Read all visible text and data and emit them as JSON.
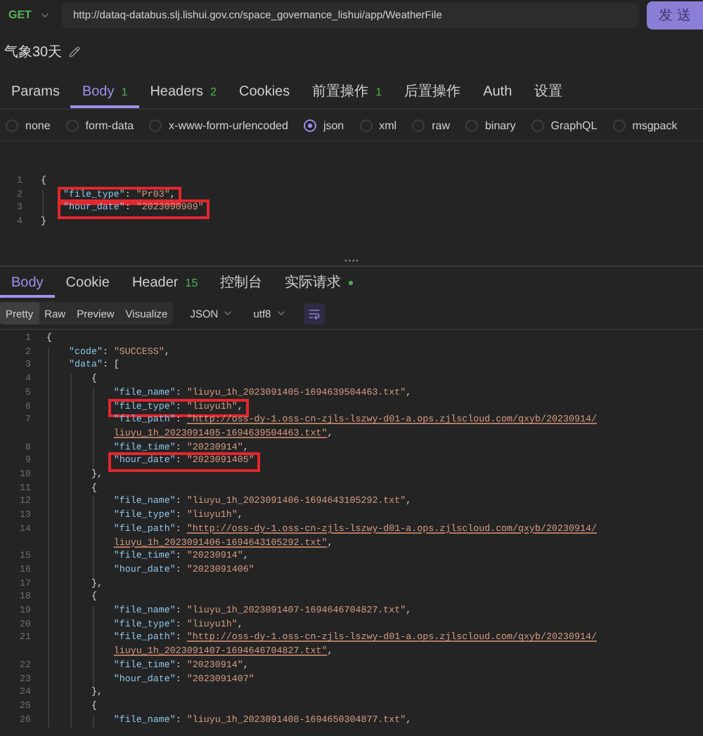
{
  "request": {
    "method": "GET",
    "url": "http://dataq-databus.slj.lishui.gov.cn/space_governance_lishui/app/WeatherFile",
    "send": "发 送"
  },
  "title": "气象30天",
  "tabs": [
    {
      "label": "Params",
      "selected": false
    },
    {
      "label": "Body",
      "count": "1",
      "selected": true
    },
    {
      "label": "Headers",
      "count": "2",
      "selected": false
    },
    {
      "label": "Cookies",
      "selected": false
    },
    {
      "label": "前置操作",
      "count": "1",
      "selected": false
    },
    {
      "label": "后置操作",
      "selected": false
    },
    {
      "label": "Auth",
      "selected": false
    },
    {
      "label": "设置",
      "selected": false
    }
  ],
  "body_types": [
    {
      "label": "none",
      "selected": false
    },
    {
      "label": "form-data",
      "selected": false
    },
    {
      "label": "x-www-form-urlencoded",
      "selected": false
    },
    {
      "label": "json",
      "selected": true
    },
    {
      "label": "xml",
      "selected": false
    },
    {
      "label": "raw",
      "selected": false
    },
    {
      "label": "binary",
      "selected": false
    },
    {
      "label": "GraphQL",
      "selected": false
    },
    {
      "label": "msgpack",
      "selected": false
    }
  ],
  "request_body": {
    "lines": [
      {
        "number": "1",
        "boxed": false,
        "tokens": [
          {
            "kind": "punct",
            "text": "{"
          }
        ],
        "children": [
          {
            "number": "2",
            "boxed": true,
            "tokens": [
              {
                "kind": "key",
                "text": "\"file_type\""
              },
              {
                "kind": "punct",
                "text": ": "
              },
              {
                "kind": "string",
                "text": "\"Pr03\""
              },
              {
                "kind": "punct",
                "text": ","
              }
            ]
          },
          {
            "number": "3",
            "boxed": true,
            "tokens": [
              {
                "kind": "key",
                "text": "\"hour_date\""
              },
              {
                "kind": "punct",
                "text": ": "
              },
              {
                "kind": "string",
                "text": "\"2023090909\""
              }
            ]
          }
        ]
      },
      {
        "number": "4",
        "boxed": false,
        "tokens": [
          {
            "kind": "punct",
            "text": "}"
          }
        ]
      }
    ]
  },
  "response": {
    "tabs": [
      {
        "label": "Body",
        "selected": true,
        "dot": false
      },
      {
        "label": "Cookie",
        "selected": false,
        "dot": false
      },
      {
        "label": "Header",
        "count": "15",
        "selected": false,
        "dot": false
      },
      {
        "label": "控制台",
        "selected": false,
        "dot": false
      },
      {
        "label": "实际请求",
        "selected": false,
        "dot": true
      }
    ],
    "views": [
      {
        "label": "Pretty",
        "selected": true
      },
      {
        "label": "Raw",
        "selected": false
      },
      {
        "label": "Preview",
        "selected": false
      },
      {
        "label": "Visualize",
        "selected": false
      }
    ],
    "format": "JSON",
    "encoding": "utf8",
    "lines": [
      {
        "number": "1",
        "boxed": false,
        "tokens": [
          {
            "kind": "punct",
            "text": "{"
          }
        ],
        "children": [
          {
            "number": "2",
            "boxed": false,
            "tokens": [
              {
                "kind": "key",
                "text": "\"code\""
              },
              {
                "kind": "punct",
                "text": ": "
              },
              {
                "kind": "string",
                "text": "\"SUCCESS\""
              },
              {
                "kind": "punct",
                "text": ","
              }
            ]
          },
          {
            "number": "3",
            "boxed": false,
            "tokens": [
              {
                "kind": "key",
                "text": "\"data\""
              },
              {
                "kind": "punct",
                "text": ": ["
              }
            ],
            "children": [
              {
                "number": "4",
                "boxed": false,
                "tokens": [
                  {
                    "kind": "punct",
                    "text": "{"
                  }
                ],
                "children": [
                  {
                    "number": "5",
                    "boxed": false,
                    "tokens": [
                      {
                        "kind": "key",
                        "text": "\"file_name\""
                      },
                      {
                        "kind": "punct",
                        "text": ": "
                      },
                      {
                        "kind": "string",
                        "text": "\"liuyu_1h_2023091405-1694639504463.txt\""
                      },
                      {
                        "kind": "punct",
                        "text": ","
                      }
                    ]
                  },
                  {
                    "number": "6",
                    "boxed": true,
                    "tokens": [
                      {
                        "kind": "key",
                        "text": "\"file_type\""
                      },
                      {
                        "kind": "punct",
                        "text": ": "
                      },
                      {
                        "kind": "string",
                        "text": "\"liuyu1h\""
                      },
                      {
                        "kind": "punct",
                        "text": ","
                      }
                    ]
                  },
                  {
                    "number": "7",
                    "boxed": false,
                    "tokens": [
                      {
                        "kind": "key",
                        "text": "\"file_path\""
                      },
                      {
                        "kind": "punct",
                        "text": ": "
                      },
                      {
                        "kind": "link",
                        "text": "\"http://oss-dy-1.oss-cn-zjls-lszwy-d01-a.ops.zjlscloud.com/qxyb/20230914/liuyu_1h_2023091405-1694639504463.txt\""
                      },
                      {
                        "kind": "punct",
                        "text": ","
                      }
                    ]
                  },
                  {
                    "number": "8",
                    "boxed": false,
                    "tokens": [
                      {
                        "kind": "key",
                        "text": "\"file_time\""
                      },
                      {
                        "kind": "punct",
                        "text": ": "
                      },
                      {
                        "kind": "string",
                        "text": "\"20230914\""
                      },
                      {
                        "kind": "punct",
                        "text": ","
                      }
                    ]
                  },
                  {
                    "number": "9",
                    "boxed": true,
                    "tokens": [
                      {
                        "kind": "key",
                        "text": "\"hour_date\""
                      },
                      {
                        "kind": "punct",
                        "text": ": "
                      },
                      {
                        "kind": "string",
                        "text": "\"2023091405\""
                      }
                    ]
                  }
                ]
              },
              {
                "number": "10",
                "boxed": false,
                "tokens": [
                  {
                    "kind": "punct",
                    "text": "},"
                  }
                ]
              },
              {
                "number": "11",
                "boxed": false,
                "tokens": [
                  {
                    "kind": "punct",
                    "text": "{"
                  }
                ],
                "children": [
                  {
                    "number": "12",
                    "boxed": false,
                    "tokens": [
                      {
                        "kind": "key",
                        "text": "\"file_name\""
                      },
                      {
                        "kind": "punct",
                        "text": ": "
                      },
                      {
                        "kind": "string",
                        "text": "\"liuyu_1h_2023091406-1694643105292.txt\""
                      },
                      {
                        "kind": "punct",
                        "text": ","
                      }
                    ]
                  },
                  {
                    "number": "13",
                    "boxed": false,
                    "tokens": [
                      {
                        "kind": "key",
                        "text": "\"file_type\""
                      },
                      {
                        "kind": "punct",
                        "text": ": "
                      },
                      {
                        "kind": "string",
                        "text": "\"liuyu1h\""
                      },
                      {
                        "kind": "punct",
                        "text": ","
                      }
                    ]
                  },
                  {
                    "number": "14",
                    "boxed": false,
                    "tokens": [
                      {
                        "kind": "key",
                        "text": "\"file_path\""
                      },
                      {
                        "kind": "punct",
                        "text": ": "
                      },
                      {
                        "kind": "link",
                        "text": "\"http://oss-dy-1.oss-cn-zjls-lszwy-d01-a.ops.zjlscloud.com/qxyb/20230914/liuyu_1h_2023091406-1694643105292.txt\""
                      },
                      {
                        "kind": "punct",
                        "text": ","
                      }
                    ]
                  },
                  {
                    "number": "15",
                    "boxed": false,
                    "tokens": [
                      {
                        "kind": "key",
                        "text": "\"file_time\""
                      },
                      {
                        "kind": "punct",
                        "text": ": "
                      },
                      {
                        "kind": "string",
                        "text": "\"20230914\""
                      },
                      {
                        "kind": "punct",
                        "text": ","
                      }
                    ]
                  },
                  {
                    "number": "16",
                    "boxed": false,
                    "tokens": [
                      {
                        "kind": "key",
                        "text": "\"hour_date\""
                      },
                      {
                        "kind": "punct",
                        "text": ": "
                      },
                      {
                        "kind": "string",
                        "text": "\"2023091406\""
                      }
                    ]
                  }
                ]
              },
              {
                "number": "17",
                "boxed": false,
                "tokens": [
                  {
                    "kind": "punct",
                    "text": "},"
                  }
                ]
              },
              {
                "number": "18",
                "boxed": false,
                "tokens": [
                  {
                    "kind": "punct",
                    "text": "{"
                  }
                ],
                "children": [
                  {
                    "number": "19",
                    "boxed": false,
                    "tokens": [
                      {
                        "kind": "key",
                        "text": "\"file_name\""
                      },
                      {
                        "kind": "punct",
                        "text": ": "
                      },
                      {
                        "kind": "string",
                        "text": "\"liuyu_1h_2023091407-1694646704827.txt\""
                      },
                      {
                        "kind": "punct",
                        "text": ","
                      }
                    ]
                  },
                  {
                    "number": "20",
                    "boxed": false,
                    "tokens": [
                      {
                        "kind": "key",
                        "text": "\"file_type\""
                      },
                      {
                        "kind": "punct",
                        "text": ": "
                      },
                      {
                        "kind": "string",
                        "text": "\"liuyu1h\""
                      },
                      {
                        "kind": "punct",
                        "text": ","
                      }
                    ]
                  },
                  {
                    "number": "21",
                    "boxed": false,
                    "tokens": [
                      {
                        "kind": "key",
                        "text": "\"file_path\""
                      },
                      {
                        "kind": "punct",
                        "text": ": "
                      },
                      {
                        "kind": "link",
                        "text": "\"http://oss-dy-1.oss-cn-zjls-lszwy-d01-a.ops.zjlscloud.com/qxyb/20230914/liuyu_1h_2023091407-1694646704827.txt\""
                      },
                      {
                        "kind": "punct",
                        "text": ","
                      }
                    ]
                  },
                  {
                    "number": "22",
                    "boxed": false,
                    "tokens": [
                      {
                        "kind": "key",
                        "text": "\"file_time\""
                      },
                      {
                        "kind": "punct",
                        "text": ": "
                      },
                      {
                        "kind": "string",
                        "text": "\"20230914\""
                      },
                      {
                        "kind": "punct",
                        "text": ","
                      }
                    ]
                  },
                  {
                    "number": "23",
                    "boxed": false,
                    "tokens": [
                      {
                        "kind": "key",
                        "text": "\"hour_date\""
                      },
                      {
                        "kind": "punct",
                        "text": ": "
                      },
                      {
                        "kind": "string",
                        "text": "\"2023091407\""
                      }
                    ]
                  }
                ]
              },
              {
                "number": "24",
                "boxed": false,
                "tokens": [
                  {
                    "kind": "punct",
                    "text": "},"
                  }
                ]
              },
              {
                "number": "25",
                "boxed": false,
                "tokens": [
                  {
                    "kind": "punct",
                    "text": "{"
                  }
                ],
                "children": [
                  {
                    "number": "26",
                    "boxed": false,
                    "tokens": [
                      {
                        "kind": "key",
                        "text": "\"file_name\""
                      },
                      {
                        "kind": "punct",
                        "text": ": "
                      },
                      {
                        "kind": "string",
                        "text": "\"liuyu_1h_2023091408-1694650304877.txt\""
                      },
                      {
                        "kind": "punct",
                        "text": ","
                      }
                    ]
                  }
                ]
              }
            ]
          }
        ]
      }
    ]
  }
}
